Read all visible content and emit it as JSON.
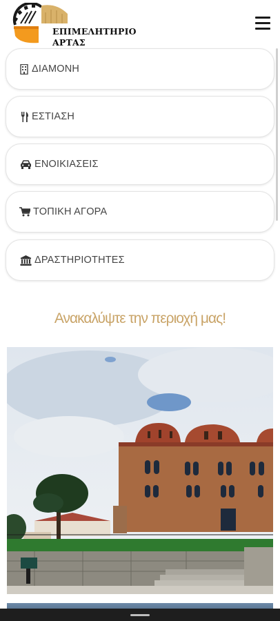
{
  "header": {
    "logo_line1": "ΕΠΙΜΕΛΗΤΗΡΙΟ",
    "logo_line2": "ΑΡΤΑΣ",
    "menu_icon": "hamburger-menu-icon"
  },
  "categories": [
    {
      "label": "ΔΙΑΜΟΝΗ",
      "icon": "building-icon"
    },
    {
      "label": "ΕΣΤΙΑΣΗ",
      "icon": "cutlery-icon"
    },
    {
      "label": "ΕΝΟΙΚΙΑΣΕΙΣ",
      "icon": "car-icon"
    },
    {
      "label": "ΤΟΠΙΚΗ ΑΓΟΡΑ",
      "icon": "shopping-cart-icon"
    },
    {
      "label": "ΔΡΑΣΤΗΡΙΟΤΗΤΕΣ",
      "icon": "institution-icon"
    }
  ],
  "discover": {
    "heading": "Ανακαλύψτε την περιοχή μας!"
  },
  "colors": {
    "accent_gold": "#c9a468",
    "logo_orange": "#f39a1e",
    "logo_tan": "#d9b26a",
    "text": "#444444"
  }
}
